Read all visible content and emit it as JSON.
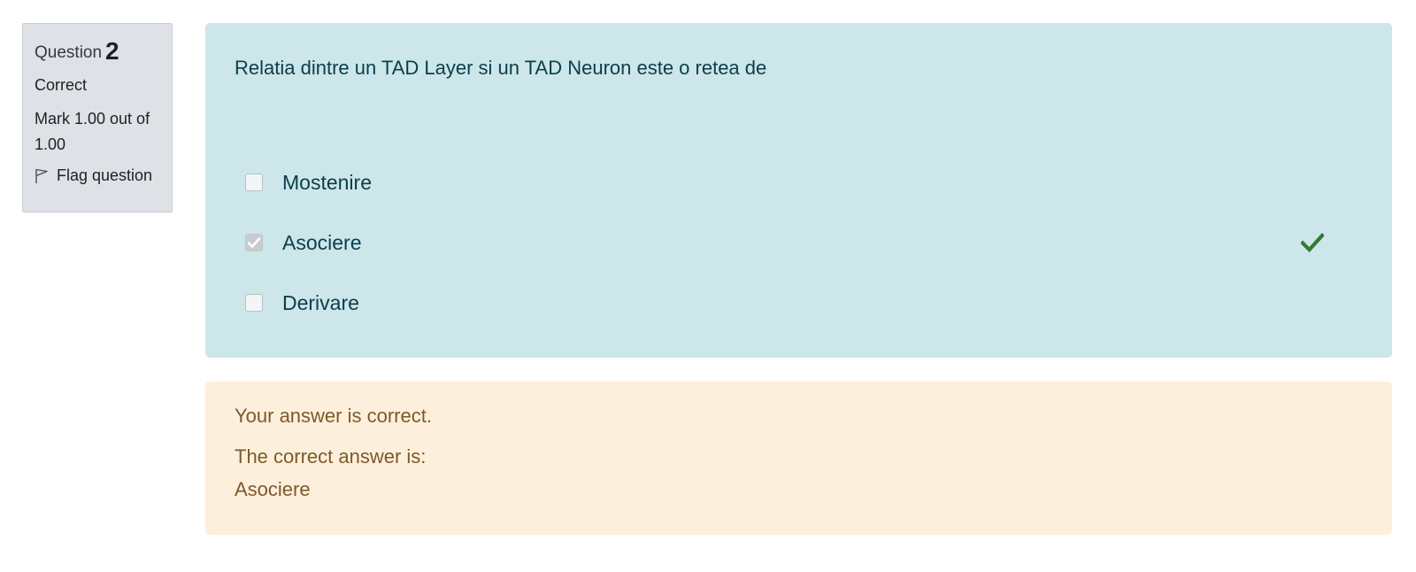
{
  "info": {
    "question_label": "Question",
    "question_number": "2",
    "state": "Correct",
    "grade": "Mark 1.00 out of 1.00",
    "flag_label": "Flag question",
    "flag_icon": "flag-outline-icon"
  },
  "question": {
    "text": "Relatia dintre un TAD Layer si un TAD Neuron este o retea de",
    "answers": [
      {
        "label": "Mostenire",
        "checked": false,
        "correct": false
      },
      {
        "label": "Asociere",
        "checked": true,
        "correct": true
      },
      {
        "label": "Derivare",
        "checked": false,
        "correct": false
      }
    ]
  },
  "outcome": {
    "feedback": "Your answer is correct.",
    "right_answer_label": "The correct answer is:",
    "right_answer_value": "Asociere"
  },
  "colors": {
    "info_bg": "#dee2e6",
    "question_bg": "#cce6ea",
    "question_text": "#0b3e4a",
    "outcome_bg": "#fcefdc",
    "outcome_text": "#7d5a29",
    "correct_icon": "#357a32"
  },
  "icons": {
    "correct": "check-icon",
    "checkbox_checked": "checkmark-icon"
  }
}
